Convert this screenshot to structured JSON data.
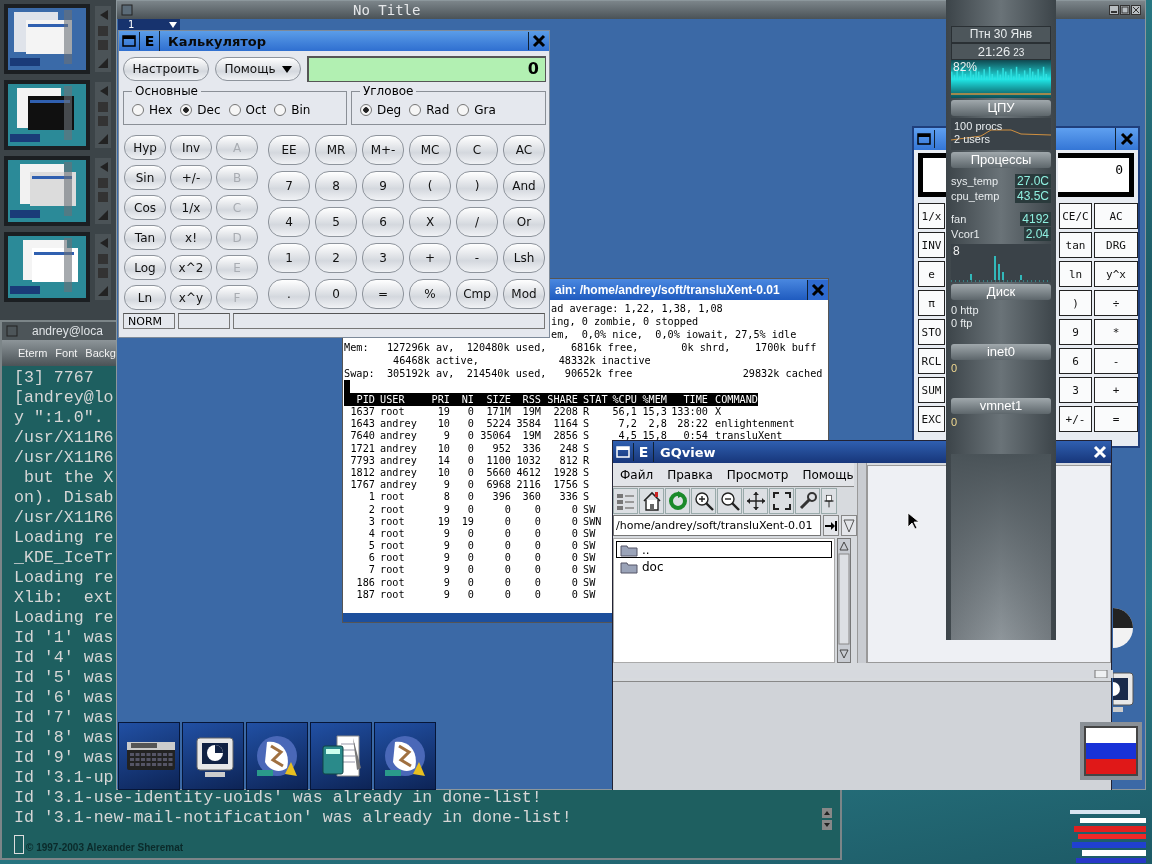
{
  "eterm": {
    "title": "andrey@loca",
    "menu": [
      "Eterm",
      "Font",
      "Backg"
    ],
    "lines": [
      "[3] 7767",
      "[andrey@lo",
      "y \":1.0\".",
      "/usr/X11R6",
      "/usr/X11R6",
      " but the X",
      "on). Disab",
      "/usr/X11R6",
      "Loading re",
      "_KDE_IceTr",
      "Loading re",
      "Xlib:  ext",
      "Loading re",
      "Id '1' was",
      "Id '4' was",
      "Id '5' was",
      "Id '6' was",
      "Id '7' was",
      "Id '8' was",
      "Id '9' was",
      "Id '3.1-up",
      "Id '3.1-use-identity-uoids' was already in done-list!",
      "Id '3.1-new-mail-notification' was already in done-list!"
    ],
    "copyright": "© 1997-2003  Alexander Sheremat"
  },
  "main_window": {
    "title": "No Title",
    "tab": "1"
  },
  "calculator": {
    "title": "Калькулятор",
    "menu_button": "E",
    "buttons": [
      "Настроить",
      "Помощь"
    ],
    "display": "0",
    "groups": [
      {
        "title": "Основные",
        "options": [
          {
            "label": "Hex",
            "selected": false
          },
          {
            "label": "Dec",
            "selected": true
          },
          {
            "label": "Oct",
            "selected": false
          },
          {
            "label": "Bin",
            "selected": false
          }
        ]
      },
      {
        "title": "Угловое",
        "options": [
          {
            "label": "Deg",
            "selected": true
          },
          {
            "label": "Rad",
            "selected": false
          },
          {
            "label": "Gra",
            "selected": false
          }
        ]
      }
    ],
    "function_keys": [
      {
        "label": "Hyp",
        "disabled": false
      },
      {
        "label": "Inv",
        "disabled": false
      },
      {
        "label": "A",
        "disabled": true
      },
      {
        "label": "Sin",
        "disabled": false
      },
      {
        "label": "+/-",
        "disabled": false
      },
      {
        "label": "B",
        "disabled": true
      },
      {
        "label": "Cos",
        "disabled": false
      },
      {
        "label": "1/x",
        "disabled": false
      },
      {
        "label": "C",
        "disabled": true
      },
      {
        "label": "Tan",
        "disabled": false
      },
      {
        "label": "x!",
        "disabled": false
      },
      {
        "label": "D",
        "disabled": true
      },
      {
        "label": "Log",
        "disabled": false
      },
      {
        "label": "x^2",
        "disabled": false
      },
      {
        "label": "E",
        "disabled": true
      },
      {
        "label": "Ln",
        "disabled": false
      },
      {
        "label": "x^y",
        "disabled": false
      },
      {
        "label": "F",
        "disabled": true
      }
    ],
    "keys": [
      "EE",
      "MR",
      "M+-",
      "MC",
      "C",
      "AC",
      "7",
      "8",
      "9",
      "(",
      ")",
      "And",
      "4",
      "5",
      "6",
      "X",
      "/",
      "Or",
      "1",
      "2",
      "3",
      "+",
      "-",
      "Lsh",
      ".",
      "0",
      "=",
      "%",
      "Cmp",
      "Mod"
    ],
    "status": "NORM"
  },
  "top": {
    "title": "ain: /home/andrey/soft/transluXent-0.01",
    "partial_lines": [
      "ad average: 1,22, 1,38, 1,08",
      "ing, 0 zombie, 0 stopped",
      "em,  0,0% nice,  0,0% iowait, 27,5% idle"
    ],
    "lines": [
      "Mem:   127296k av,  120480k used,    6816k free,       0k shrd,    1700k buff",
      "        46468k active,             48332k inactive",
      "Swap:  305192k av,  214540k used,   90652k free                  29832k cached"
    ],
    "columns": [
      "PID",
      "USER",
      "PRI",
      "NI",
      "SIZE",
      "RSS",
      "SHARE",
      "STAT",
      "%CPU",
      "%MEM",
      "TIME",
      "COMMAND"
    ],
    "rows": [
      [
        "1637",
        "root",
        "19",
        "0",
        "171M",
        "19M",
        "2208",
        "R",
        "56,1",
        "15,3",
        "133:00",
        "X"
      ],
      [
        "1643",
        "andrey",
        "10",
        "0",
        "5224",
        "3584",
        "1164",
        "S",
        "7,2",
        "2,8",
        "28:22",
        "enlightenment"
      ],
      [
        "7640",
        "andrey",
        "9",
        "0",
        "35064",
        "19M",
        "2856",
        "S",
        "4,5",
        "15,8",
        "0:54",
        "transluXent"
      ],
      [
        "1721",
        "andrey",
        "10",
        "0",
        "952",
        "336",
        "248",
        "S"
      ],
      [
        "7793",
        "andrey",
        "14",
        "0",
        "1100",
        "1032",
        "812",
        "R"
      ],
      [
        "1812",
        "andrey",
        "10",
        "0",
        "5660",
        "4612",
        "1928",
        "S"
      ],
      [
        "1767",
        "andrey",
        "9",
        "0",
        "6968",
        "2116",
        "1756",
        "S"
      ],
      [
        "1",
        "root",
        "8",
        "0",
        "396",
        "360",
        "336",
        "S"
      ],
      [
        "2",
        "root",
        "9",
        "0",
        "0",
        "0",
        "0",
        "SW"
      ],
      [
        "3",
        "root",
        "19",
        "19",
        "0",
        "0",
        "0",
        "SWN"
      ],
      [
        "4",
        "root",
        "9",
        "0",
        "0",
        "0",
        "0",
        "SW"
      ],
      [
        "5",
        "root",
        "9",
        "0",
        "0",
        "0",
        "0",
        "SW"
      ],
      [
        "6",
        "root",
        "9",
        "0",
        "0",
        "0",
        "0",
        "SW"
      ],
      [
        "7",
        "root",
        "9",
        "0",
        "0",
        "0",
        "0",
        "SW"
      ],
      [
        "186",
        "root",
        "9",
        "0",
        "0",
        "0",
        "0",
        "SW"
      ],
      [
        "187",
        "root",
        "9",
        "0",
        "0",
        "0",
        "0",
        "SW"
      ]
    ]
  },
  "gqview": {
    "title": "GQview",
    "menu_button": "E",
    "menu": [
      "Файл",
      "Правка",
      "Просмотр",
      "Помощь"
    ],
    "path": "/home/andrey/soft/transluXent-0.01",
    "files": [
      {
        "name": "..",
        "selected": true
      },
      {
        "name": "doc",
        "selected": false
      }
    ]
  },
  "xcalc": {
    "display": "0",
    "keys": [
      [
        "1/x",
        "CE/C",
        "AC"
      ],
      [
        "INV",
        "tan",
        "DRG"
      ],
      [
        "e",
        "ln",
        "y^x"
      ],
      [
        "π",
        ")",
        "÷"
      ],
      [
        "STO",
        "9",
        "*"
      ],
      [
        "RCL",
        "6",
        "-"
      ],
      [
        "SUM",
        "3",
        "+"
      ],
      [
        "EXC",
        "+/-",
        "="
      ]
    ]
  },
  "gkrellm": {
    "date": "Птн 30 Янв",
    "time": "21:26",
    "seconds": "23",
    "cpu_percent": "82%",
    "cpu_label": "ЦПУ",
    "procs": "100 procs",
    "users": "2 users",
    "proc_label": "Процессы",
    "sensors": [
      {
        "name": "sys_temp",
        "value": "27.0C"
      },
      {
        "name": "cpu_temp",
        "value": "43.5C"
      },
      {
        "name": "fan",
        "value": "4192"
      },
      {
        "name": "Vcor1",
        "value": "2.04"
      }
    ],
    "disk_value": "8",
    "disk_label": "Диск",
    "services": [
      "0 http",
      "0 ftp"
    ],
    "networks": [
      {
        "name": "inet0",
        "value": "0"
      },
      {
        "name": "vmnet1",
        "value": "0"
      }
    ]
  },
  "launcher": {
    "icons": [
      {
        "kind": "calculator"
      },
      {
        "kind": "monitor"
      },
      {
        "kind": "globe"
      },
      {
        "kind": "spreadsheet"
      },
      {
        "kind": "globe"
      }
    ]
  }
}
